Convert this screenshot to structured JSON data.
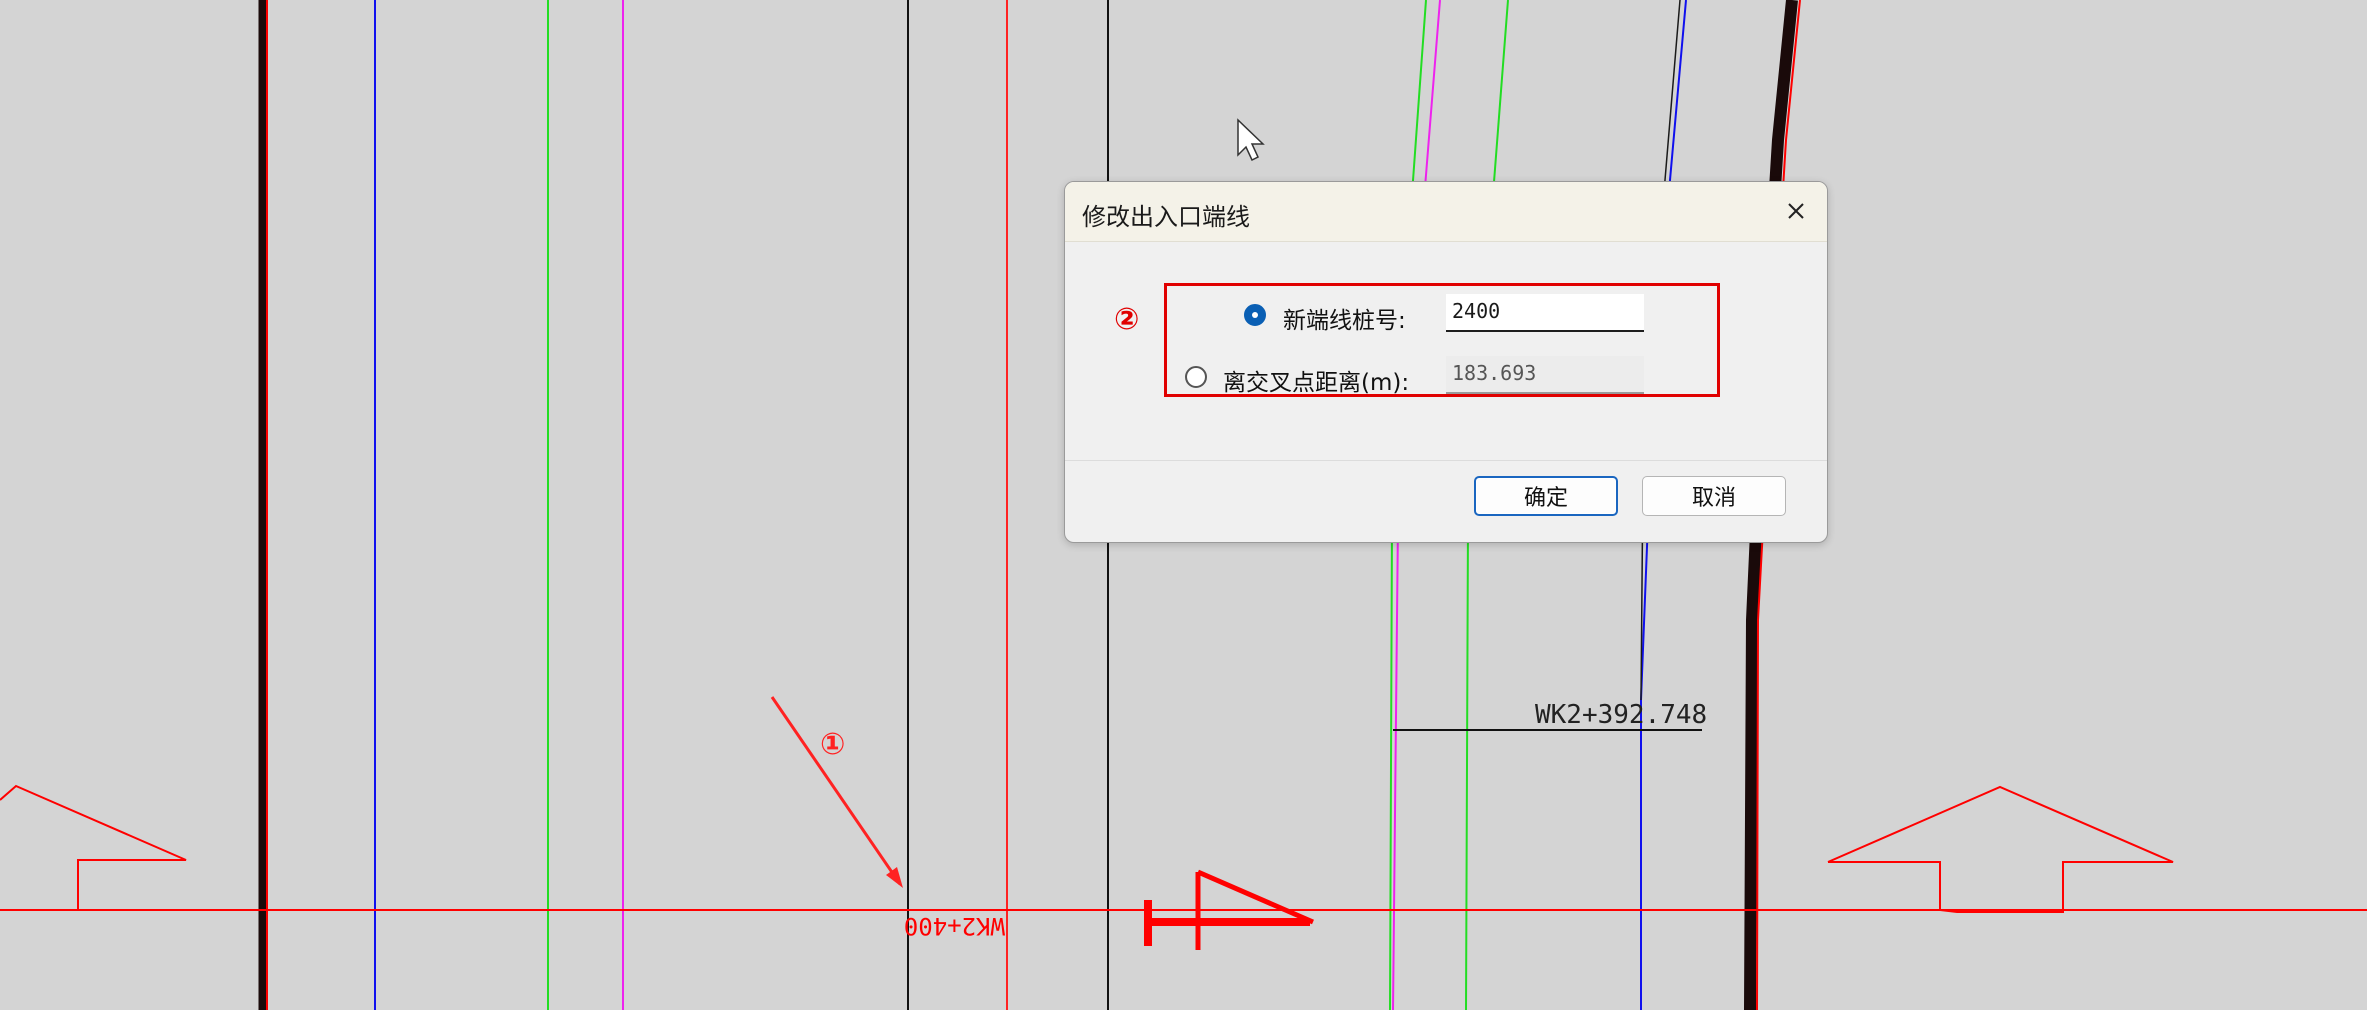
{
  "canvas": {
    "station_label_top": "WK2+392.748",
    "station_label_bottom": "WK2+400",
    "annotation_1": "①",
    "colors": {
      "background": "#d4d4d4",
      "red": "#ff0000",
      "blue": "#1010ee",
      "green": "#22dd22",
      "magenta": "#ee22ee",
      "dark": "#1a0a0a"
    }
  },
  "dialog": {
    "title": "修改出入口端线",
    "close_icon": "close-icon",
    "annotation_2": "②",
    "options": [
      {
        "label": "新端线桩号:",
        "value": "2400",
        "selected": true
      },
      {
        "label": "离交叉点距离(m):",
        "value": "183.693",
        "selected": false
      }
    ],
    "ok_label": "确定",
    "cancel_label": "取消"
  }
}
